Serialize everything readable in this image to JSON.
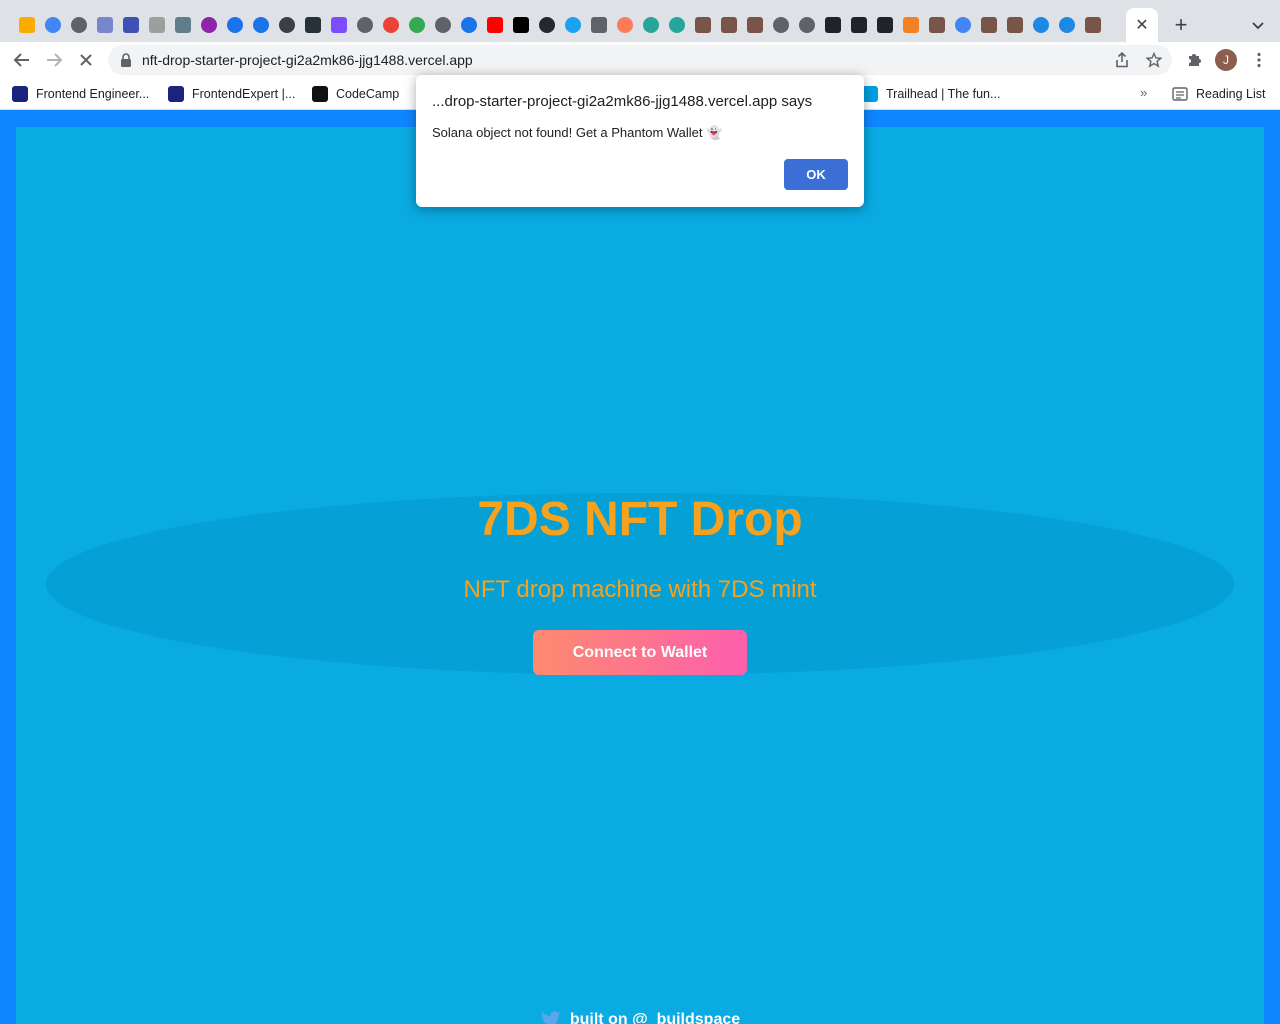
{
  "browser": {
    "tab_close_glyph": "✕",
    "new_tab_glyph": "+",
    "address": "nft-drop-starter-project-gi2a2mk86-jjg1488.vercel.app",
    "profile_initial": "J",
    "tab_favicons": [
      {
        "color": "#f9ab00",
        "shape": "sq"
      },
      {
        "color": "#4285f4",
        "shape": "round"
      },
      {
        "color": "#5f6368",
        "shape": "round"
      },
      {
        "color": "#7986cb",
        "shape": "sq"
      },
      {
        "color": "#3f51b5",
        "shape": "sq"
      },
      {
        "color": "#9e9e9e",
        "shape": "sq"
      },
      {
        "color": "#607d8b",
        "shape": "sq"
      },
      {
        "color": "#8e24aa",
        "shape": "round"
      },
      {
        "color": "#1a73e8",
        "shape": "round"
      },
      {
        "color": "#1a73e8",
        "shape": "round"
      },
      {
        "color": "#3c4043",
        "shape": "round"
      },
      {
        "color": "#263238",
        "shape": "sq"
      },
      {
        "color": "#7c4dff",
        "shape": "sq"
      },
      {
        "color": "#5f6368",
        "shape": "round"
      },
      {
        "color": "#ea4335",
        "shape": "round"
      },
      {
        "color": "#34a853",
        "shape": "round"
      },
      {
        "color": "#5f6368",
        "shape": "round"
      },
      {
        "color": "#1a73e8",
        "shape": "round"
      },
      {
        "color": "#ff0000",
        "shape": "sq"
      },
      {
        "color": "#000000",
        "shape": "sq"
      },
      {
        "color": "#24292e",
        "shape": "round"
      },
      {
        "color": "#1da1f2",
        "shape": "round"
      },
      {
        "color": "#5f6368",
        "shape": "sq"
      },
      {
        "color": "#ff7a59",
        "shape": "round"
      },
      {
        "color": "#26a69a",
        "shape": "round"
      },
      {
        "color": "#26a69a",
        "shape": "round"
      },
      {
        "color": "#795548",
        "shape": "sq"
      },
      {
        "color": "#795548",
        "shape": "sq"
      },
      {
        "color": "#795548",
        "shape": "sq"
      },
      {
        "color": "#5f6368",
        "shape": "round"
      },
      {
        "color": "#5f6368",
        "shape": "round"
      },
      {
        "color": "#20232a",
        "shape": "sq"
      },
      {
        "color": "#20232a",
        "shape": "sq"
      },
      {
        "color": "#20232a",
        "shape": "sq"
      },
      {
        "color": "#f48024",
        "shape": "sq"
      },
      {
        "color": "#795548",
        "shape": "sq"
      },
      {
        "color": "#4285f4",
        "shape": "round"
      },
      {
        "color": "#795548",
        "shape": "sq"
      },
      {
        "color": "#795548",
        "shape": "sq"
      },
      {
        "color": "#1e88e5",
        "shape": "round"
      },
      {
        "color": "#1e88e5",
        "shape": "round"
      },
      {
        "color": "#795548",
        "shape": "sq"
      }
    ]
  },
  "bookmarks": {
    "items": [
      {
        "label": "Frontend Engineer...",
        "icon_color": "#1a237e"
      },
      {
        "label": "FrontendExpert |...",
        "icon_color": "#1a237e"
      },
      {
        "label": "CodeCamp",
        "icon_color": "#111111"
      },
      {
        "label": "Trailhead | The fun...",
        "icon_color": "#00a1e0"
      }
    ],
    "more_glyph": "»",
    "reading_list": "Reading List"
  },
  "page": {
    "title": "7DS NFT Drop",
    "subtitle": "NFT drop machine with 7DS mint",
    "connect_button": "Connect to Wallet",
    "footer_text": "built on @_buildspace"
  },
  "dialog": {
    "title": "...drop-starter-project-gi2a2mk86-jjg1488.vercel.app says",
    "message": "Solana object not found! Get a Phantom Wallet 👻",
    "ok_label": "OK"
  },
  "colors": {
    "frame": "#0e86ff",
    "page_bg": "#0aaae2",
    "title_color": "#f6a21e",
    "button_gradient_start": "#fd8a6f",
    "button_gradient_end": "#fd5fad",
    "ok_button": "#3b6fd6"
  }
}
